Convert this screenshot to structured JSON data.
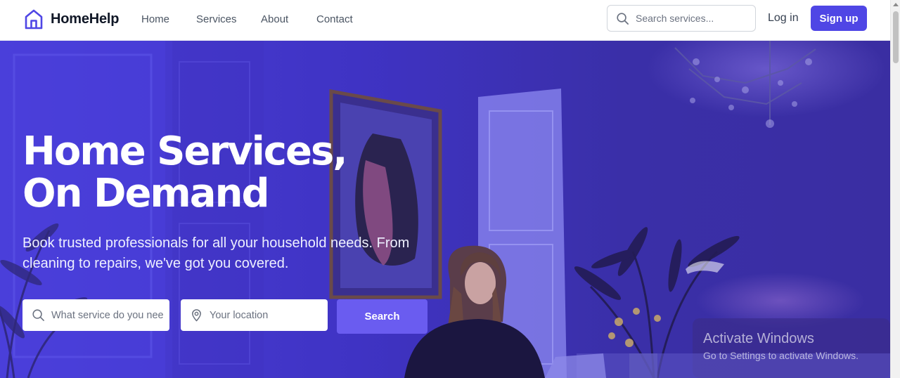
{
  "brand": {
    "name": "HomeHelp",
    "icon": "house-icon",
    "accent": "#4f46e5"
  },
  "nav": {
    "links": [
      "Home",
      "Services",
      "About",
      "Contact"
    ],
    "search_placeholder": "Search services...",
    "search_icon": "search-icon",
    "login_label": "Log in",
    "signup_label": "Sign up"
  },
  "hero": {
    "title_line1": "Home Services,",
    "title_line2": "On Demand",
    "subtitle": "Book trusted professionals for all your household needs. From cleaning to repairs, we've got you covered.",
    "service_placeholder": "What service do you need?",
    "location_placeholder": "Your location",
    "location_icon": "map-pin-icon",
    "search_label": "Search",
    "search_button_color": "#6a5cf0"
  },
  "watermark": {
    "title": "Activate Windows",
    "subtitle": "Go to Settings to activate Windows."
  }
}
